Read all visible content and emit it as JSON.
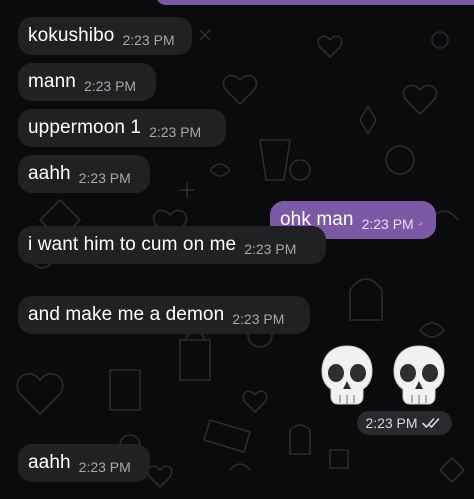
{
  "chat": {
    "incoming_bg": "#212124",
    "outgoing_bg": "#7b59a4",
    "messages": [
      {
        "text": "kokushibo",
        "time": "2:23 PM",
        "direction": "in"
      },
      {
        "text": "mann",
        "time": "2:23 PM",
        "direction": "in"
      },
      {
        "text": "uppermoon 1",
        "time": "2:23 PM",
        "direction": "in"
      },
      {
        "text": "aahh",
        "time": "2:23 PM",
        "direction": "in"
      },
      {
        "text": "ohk man",
        "time": "2:23 PM",
        "direction": "out",
        "status_icon": "double-check-icon"
      },
      {
        "text": "i want him to cum on me",
        "time": "2:23 PM",
        "direction": "in"
      },
      {
        "text": "and make me a demon",
        "time": "2:23 PM",
        "direction": "in"
      },
      {
        "text": "",
        "time": "2:23 PM",
        "direction": "out",
        "content_icons": [
          "skull-emoji",
          "skull-emoji"
        ],
        "status_icon": "double-check-icon"
      },
      {
        "text": "aahh",
        "time": "2:23 PM",
        "direction": "in"
      }
    ]
  }
}
